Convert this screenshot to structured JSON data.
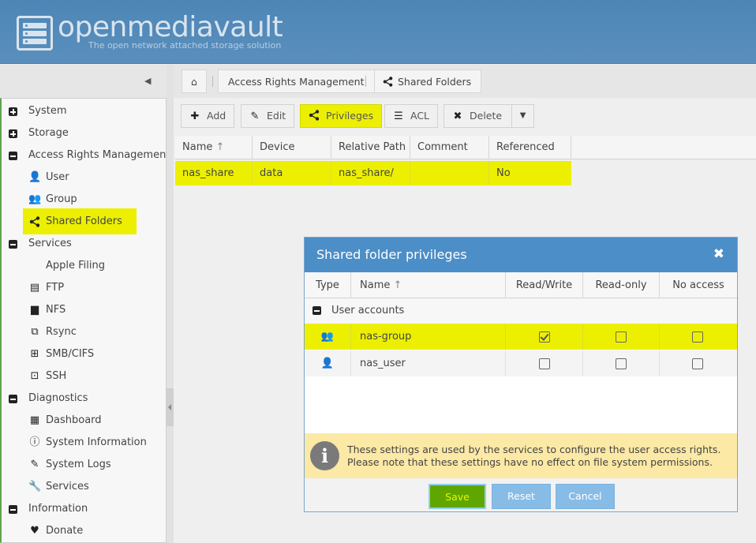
{
  "app": {
    "brand": "openmediavault",
    "tagline": "The open network attached storage solution"
  },
  "breadcrumb": {
    "items": [
      "Access Rights Management",
      "Shared Folders"
    ]
  },
  "sidebar": {
    "items": [
      {
        "label": "System"
      },
      {
        "label": "Storage"
      },
      {
        "label": "Access Rights Management"
      },
      {
        "label": "User"
      },
      {
        "label": "Group"
      },
      {
        "label": "Shared Folders"
      },
      {
        "label": "Services"
      },
      {
        "label": "Apple Filing"
      },
      {
        "label": "FTP"
      },
      {
        "label": "NFS"
      },
      {
        "label": "Rsync"
      },
      {
        "label": "SMB/CIFS"
      },
      {
        "label": "SSH"
      },
      {
        "label": "Diagnostics"
      },
      {
        "label": "Dashboard"
      },
      {
        "label": "System Information"
      },
      {
        "label": "System Logs"
      },
      {
        "label": "Services"
      },
      {
        "label": "Information"
      },
      {
        "label": "Donate"
      }
    ]
  },
  "toolbar": {
    "add": "Add",
    "edit": "Edit",
    "privileges": "Privileges",
    "acl": "ACL",
    "delete": "Delete"
  },
  "grid": {
    "columns": [
      "Name",
      "Device",
      "Relative Path",
      "Comment",
      "Referenced"
    ],
    "rows": [
      {
        "name": "nas_share",
        "device": "data",
        "path": "nas_share/",
        "comment": "",
        "referenced": "No"
      }
    ]
  },
  "dialog": {
    "title": "Shared folder privileges",
    "columns": [
      "Type",
      "Name",
      "Read/Write",
      "Read-only",
      "No access"
    ],
    "group_label": "User accounts",
    "rows": [
      {
        "name": "nas-group",
        "read_write": true,
        "read_only": false,
        "no_access": false
      },
      {
        "name": "nas_user",
        "read_write": false,
        "read_only": false,
        "no_access": false
      }
    ],
    "info_line1": "These settings are used by the services to configure the user access rights.",
    "info_line2": "Please note that these settings have no effect on file system permissions.",
    "buttons": {
      "save": "Save",
      "reset": "Reset",
      "cancel": "Cancel"
    }
  }
}
